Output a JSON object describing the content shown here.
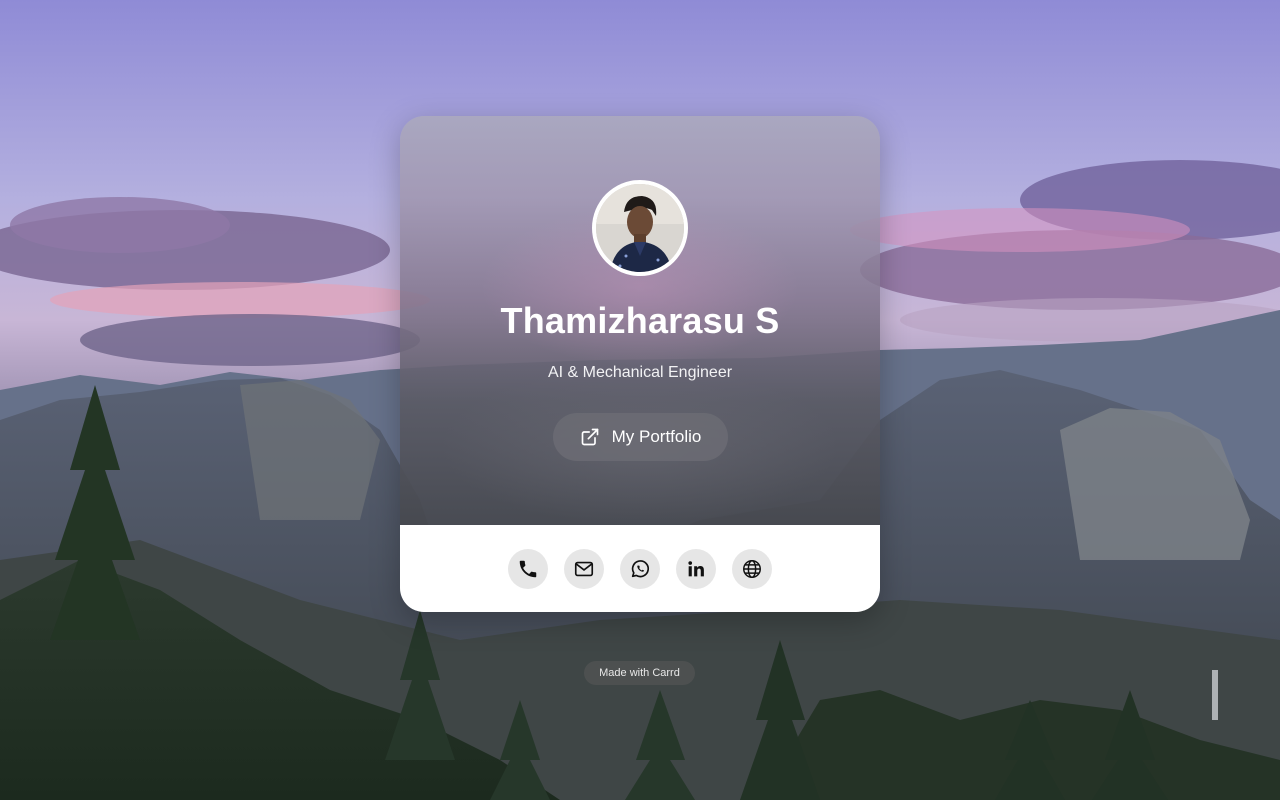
{
  "profile": {
    "name": "Thamizharasu S",
    "role": "AI & Mechanical Engineer",
    "avatar_icon": "avatar-photo"
  },
  "portfolio_button": {
    "label": "My Portfolio",
    "icon": "external-link-icon"
  },
  "socials": [
    {
      "name": "phone",
      "icon": "phone-icon"
    },
    {
      "name": "email",
      "icon": "mail-icon"
    },
    {
      "name": "whatsapp",
      "icon": "whatsapp-icon"
    },
    {
      "name": "linkedin",
      "icon": "linkedin-icon"
    },
    {
      "name": "website",
      "icon": "globe-icon"
    }
  ],
  "footer": {
    "made_with": "Made with Carrd"
  },
  "colors": {
    "card_bottom": "#ffffff",
    "social_bg": "#e6e6e6",
    "text_light": "#ffffff"
  }
}
